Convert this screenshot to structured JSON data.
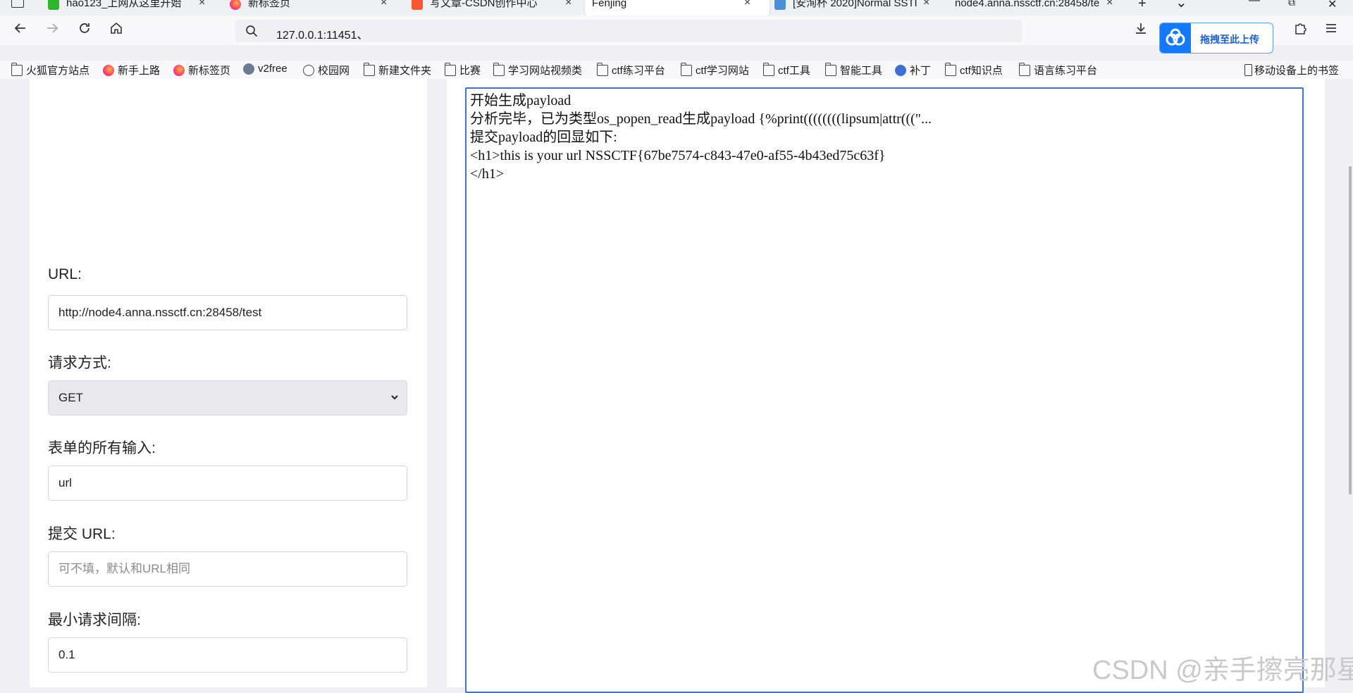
{
  "tabs": [
    {
      "label": "hao123_上网从这里开始",
      "icon_color": "#2db52d",
      "active": false
    },
    {
      "label": "新标签页",
      "icon_color": "#ff7139",
      "active": false
    },
    {
      "label": "写文章-CSDN创作中心",
      "icon_color": "#fc5531",
      "active": false
    },
    {
      "label": "Fenjing",
      "icon_color": "",
      "active": true
    },
    {
      "label": "[安洵杯 2020]Normal SSTI",
      "icon_color": "#4a90d9",
      "active": false
    },
    {
      "label": "node4.anna.nssctf.cn:28458/te",
      "icon_color": "",
      "active": false
    }
  ],
  "tab_close_glyph": "×",
  "new_tab_glyph": "+",
  "tab_list_glyph": "⌄",
  "window_controls": [
    "—",
    "⧉",
    "✕"
  ],
  "nav": {
    "back_icon": "arrow-left-icon",
    "forward_icon": "arrow-right-icon",
    "reload_icon": "reload-icon",
    "home_icon": "home-icon",
    "url": "127.0.0.1:11451、",
    "baidu_button": "拖拽至此上传",
    "accent": "#1479ff"
  },
  "bookmarks": [
    {
      "label": "火狐官方站点",
      "icon": "folder-icon"
    },
    {
      "label": "新手上路",
      "icon": "firefox-icon"
    },
    {
      "label": "新标签页",
      "icon": "firefox-icon"
    },
    {
      "label": "v2free",
      "icon": "telegram-icon"
    },
    {
      "label": "校园网",
      "icon": "globe-icon"
    },
    {
      "label": "新建文件夹",
      "icon": "folder-icon"
    },
    {
      "label": "比赛",
      "icon": "folder-icon"
    },
    {
      "label": "学习网站视频类",
      "icon": "folder-icon"
    },
    {
      "label": "ctf练习平台",
      "icon": "folder-icon"
    },
    {
      "label": "ctf学习网站",
      "icon": "folder-icon"
    },
    {
      "label": "ctf工具",
      "icon": "folder-icon"
    },
    {
      "label": "智能工具",
      "icon": "folder-icon"
    },
    {
      "label": "补丁",
      "icon": "site-icon"
    },
    {
      "label": "ctf知识点",
      "icon": "folder-icon"
    },
    {
      "label": "语言练习平台",
      "icon": "folder-icon"
    }
  ],
  "mobile_bookmarks": "移动设备上的书签",
  "form": {
    "url_label": "URL:",
    "url_value": "http://node4.anna.nssctf.cn:28458/test",
    "method_label": "请求方式:",
    "method_value": "GET",
    "inputs_label": "表单的所有输入:",
    "inputs_value": "url",
    "submit_url_label": "提交 URL:",
    "submit_url_placeholder": "可不填，默认和URL相同",
    "interval_label": "最小请求间隔:",
    "interval_value": "0.1"
  },
  "output": {
    "lines": [
      "开始生成payload",
      "分析完毕，已为类型os_popen_read生成payload {%print((((((((lipsum|attr(((\"...",
      "提交payload的回显如下:",
      "<h1>this is your url NSSCTF{67be7574-c843-47e0-af55-4b43ed75c63f}",
      "</h1>"
    ]
  },
  "watermark": "CSDN @亲手擦亮那星"
}
